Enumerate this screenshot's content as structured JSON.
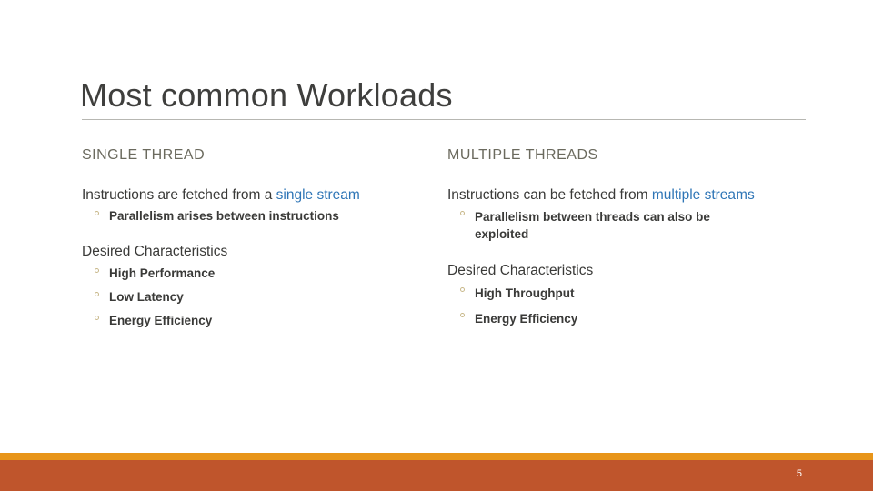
{
  "slide": {
    "title": "Most common Workloads",
    "page_number": "5",
    "accent_blue": "#2e75b6",
    "header_gray": "#6b6a5e",
    "footer_stripe_color": "#e8951a",
    "footer_band_color": "#bf552c",
    "bullet_glyph": "hollow-circle"
  },
  "columns": {
    "left": {
      "header": "SINGLE THREAD",
      "lead_prefix": "Instructions are fetched from a ",
      "lead_highlight": "single stream",
      "lead_bullets": [
        "Parallelism arises between instructions"
      ],
      "section_title": "Desired Characteristics",
      "section_bullets": [
        "High Performance",
        "Low Latency",
        "Energy Efficiency"
      ]
    },
    "right": {
      "header": "MULTIPLE THREADS",
      "lead_prefix": "Instructions can be fetched from ",
      "lead_highlight": "multiple streams",
      "lead_bullets": [
        "Parallelism between threads can also be exploited"
      ],
      "section_title": "Desired Characteristics",
      "section_bullets": [
        "High Throughput",
        "Energy Efficiency"
      ]
    }
  }
}
